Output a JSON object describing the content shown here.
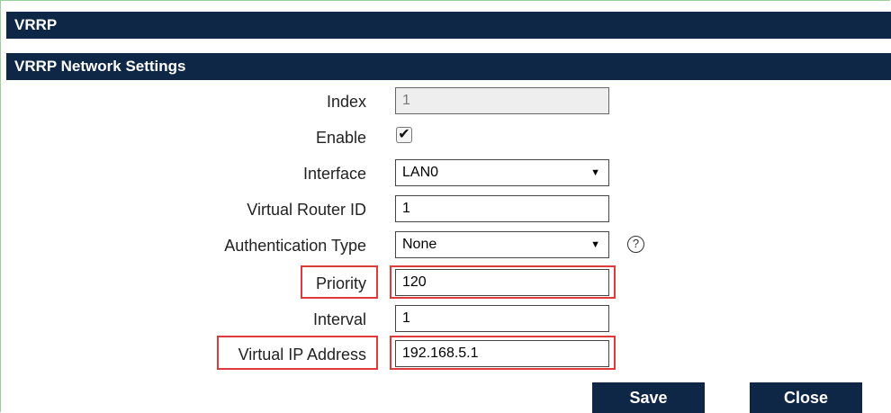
{
  "header": {
    "title": "VRRP"
  },
  "section": {
    "title": "VRRP Network Settings"
  },
  "form": {
    "index": {
      "label": "Index",
      "value": "1"
    },
    "enable": {
      "label": "Enable",
      "checked_glyph": "✔"
    },
    "interface": {
      "label": "Interface",
      "value": "LAN0"
    },
    "vrid": {
      "label": "Virtual Router ID",
      "value": "1"
    },
    "auth": {
      "label": "Authentication Type",
      "value": "None",
      "help_glyph": "?"
    },
    "priority": {
      "label": "Priority",
      "value": "120"
    },
    "interval": {
      "label": "Interval",
      "value": "1"
    },
    "vip": {
      "label": "Virtual IP Address",
      "value": "192.168.5.1"
    }
  },
  "buttons": {
    "save": "Save",
    "close": "Close"
  },
  "colors": {
    "header_bg": "#0f2747",
    "highlight": "#e03b3b"
  },
  "icons": {
    "dropdown": "chevron-down-icon",
    "help": "help-icon",
    "check": "check-icon"
  }
}
